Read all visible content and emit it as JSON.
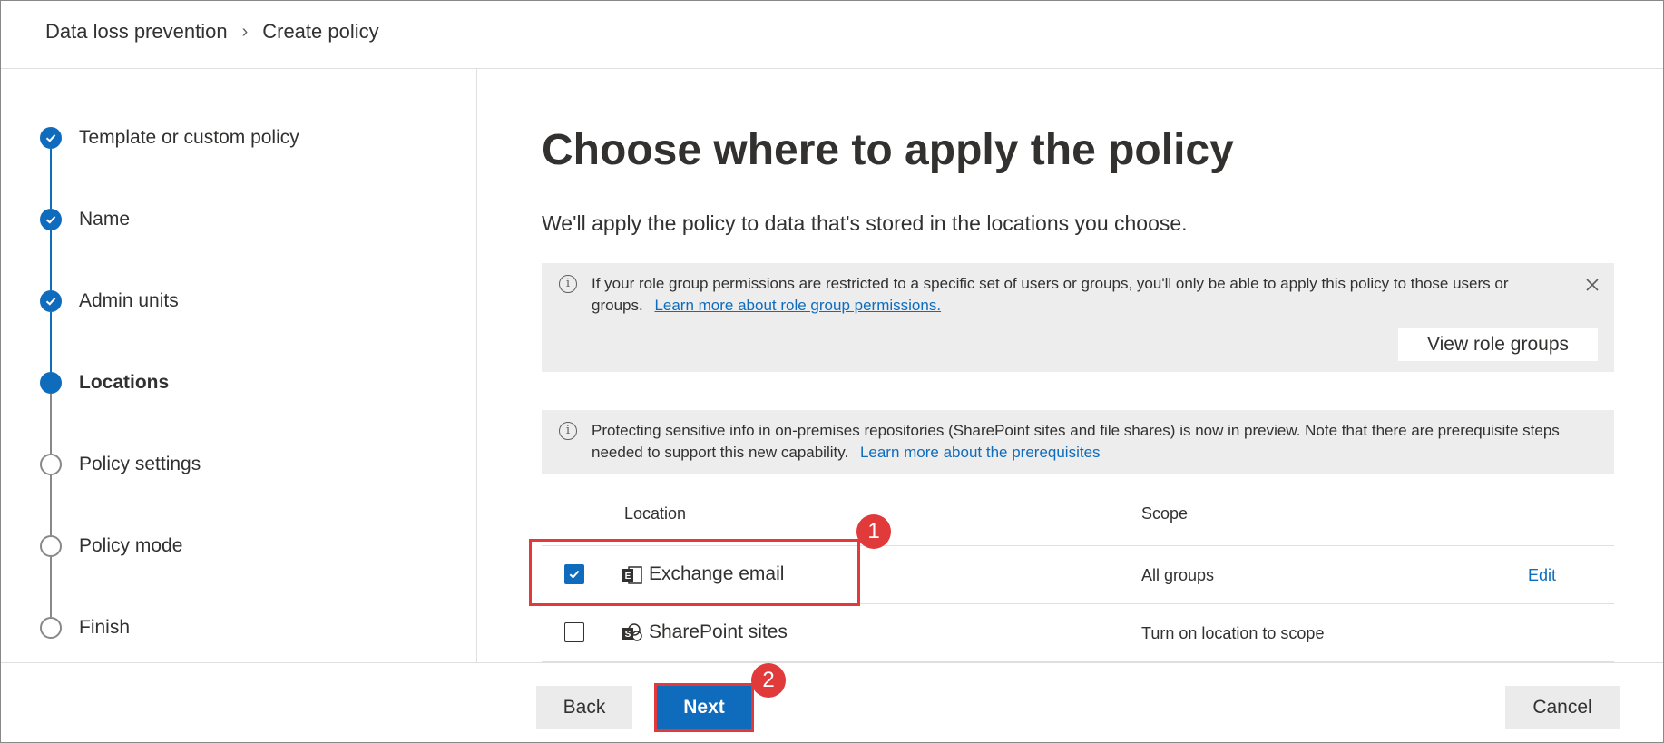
{
  "breadcrumb": {
    "parent": "Data loss prevention",
    "current": "Create policy"
  },
  "steps": [
    {
      "label": "Template or custom policy",
      "state": "done"
    },
    {
      "label": "Name",
      "state": "done"
    },
    {
      "label": "Admin units",
      "state": "done"
    },
    {
      "label": "Locations",
      "state": "current"
    },
    {
      "label": "Policy settings",
      "state": "todo"
    },
    {
      "label": "Policy mode",
      "state": "todo"
    },
    {
      "label": "Finish",
      "state": "todo"
    }
  ],
  "main": {
    "title": "Choose where to apply the policy",
    "subtitle": "We'll apply the policy to data that's stored in the locations you choose."
  },
  "info_role": {
    "text": "If your role group permissions are restricted to a specific set of users or groups, you'll only be able to apply this policy to those users or groups.",
    "link": "Learn more about role group permissions.",
    "button": "View role groups"
  },
  "info_onprem": {
    "text": "Protecting sensitive info in on-premises repositories (SharePoint sites and file shares) is now in preview. Note that there are prerequisite steps needed to support this new capability.",
    "link": "Learn more about the prerequisites"
  },
  "table": {
    "headers": {
      "location": "Location",
      "scope": "Scope"
    },
    "rows": [
      {
        "name": "Exchange email",
        "checked": true,
        "scope": "All groups",
        "action": "Edit",
        "icon": "exchange-icon"
      },
      {
        "name": "SharePoint sites",
        "checked": false,
        "scope": "Turn on location to scope",
        "action": "",
        "icon": "sharepoint-icon"
      }
    ]
  },
  "annotations": {
    "badge1": "1",
    "badge2": "2",
    "color": "#e03a3a"
  },
  "footer": {
    "back": "Back",
    "next": "Next",
    "cancel": "Cancel"
  },
  "colors": {
    "accent": "#0f6cbd",
    "info_bg": "#ededed",
    "step_todo": "#8a8886"
  }
}
